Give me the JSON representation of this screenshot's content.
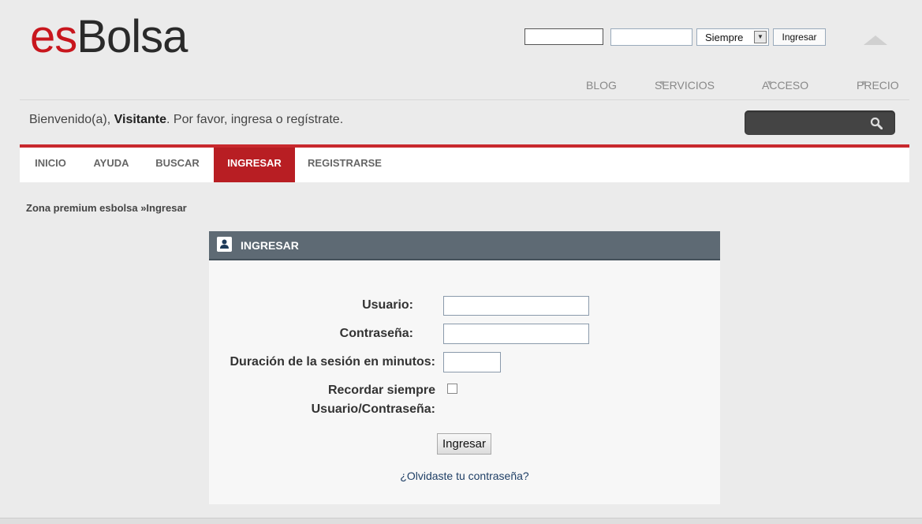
{
  "logo": {
    "part1": "es",
    "part2": "Bolsa"
  },
  "quick_login": {
    "username_value": "",
    "password_value": "",
    "duration_selected": "Siempre",
    "submit_label": "Ingresar"
  },
  "top_nav": {
    "blog": "BLOG",
    "servicios": "SERVICIOS",
    "acceso": "ACCESO",
    "precio": "PRECIO",
    "caret": "▼"
  },
  "welcome": {
    "prefix": "Bienvenido(a), ",
    "name": "Visitante",
    "suffix": ". Por favor, ingresa o regístrate."
  },
  "tabs": {
    "inicio": "INICIO",
    "ayuda": "AYUDA",
    "buscar": "BUSCAR",
    "ingresar": "INGRESAR",
    "registrarse": "REGISTRARSE"
  },
  "breadcrumb": "Zona premium esbolsa »Ingresar",
  "login_panel": {
    "title": "INGRESAR",
    "usuario_label": "Usuario:",
    "password_label": "Contraseña:",
    "duration_label": "Duración de la sesión en minutos:",
    "remember_label_line1": "Recordar siempre",
    "remember_label_line2": "Usuario/Contraseña:",
    "submit_label": "Ingresar",
    "forgot_link": "¿Olvidaste tu contraseña?"
  },
  "colors": {
    "brand_red": "#c8161d",
    "tab_active": "#b81e23",
    "panel_header": "#5e6a74",
    "background": "#ebebeb"
  }
}
